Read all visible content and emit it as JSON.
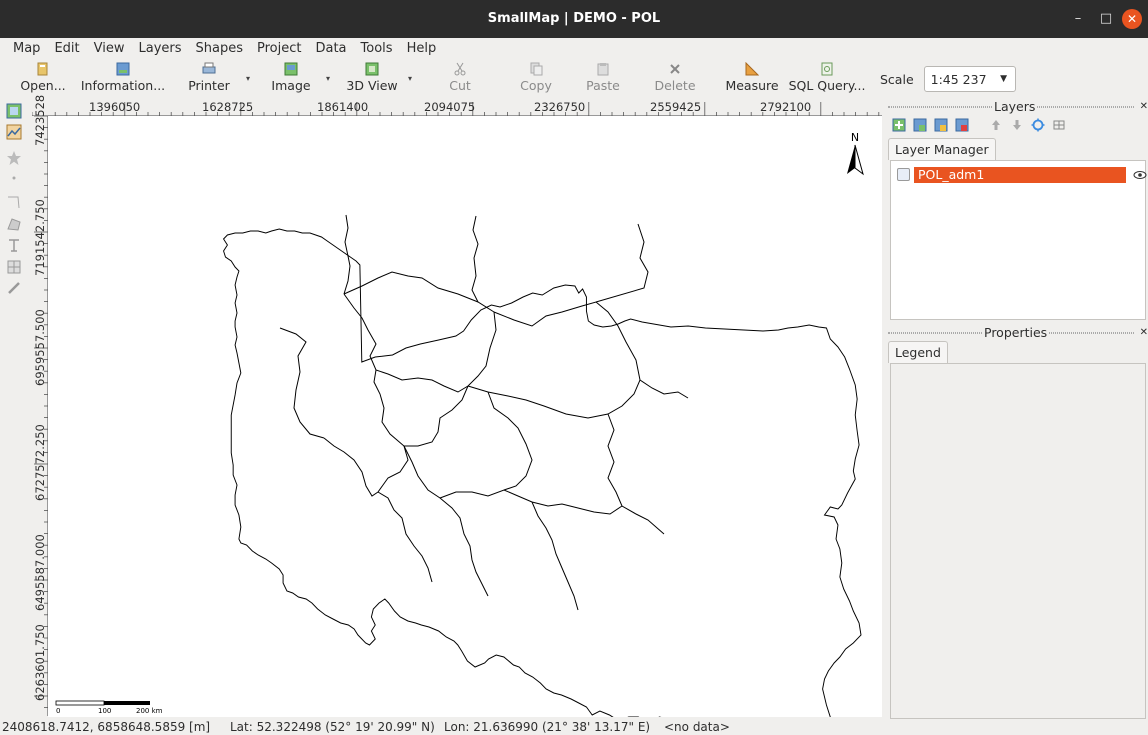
{
  "window": {
    "title": "SmallMap | DEMO - POL",
    "min_glyph": "–",
    "max_glyph": "□",
    "close_glyph": "✕"
  },
  "menu": [
    "Map",
    "Edit",
    "View",
    "Layers",
    "Shapes",
    "Project",
    "Data",
    "Tools",
    "Help"
  ],
  "toolbar": {
    "open": "Open...",
    "information": "Information...",
    "printer": "Printer",
    "image": "Image",
    "view3d": "3D View",
    "cut": "Cut",
    "copy": "Copy",
    "paste": "Paste",
    "delete": "Delete",
    "measure": "Measure",
    "sql": "SQL Query...",
    "scale_label": "Scale",
    "scale_value": "1:45 237",
    "dropdown_glyph": "▾",
    "scale_dropdown_glyph": "▼"
  },
  "ruler": {
    "x_labels": [
      "1396050",
      "1628725",
      "1861400",
      "2094075",
      "2326750",
      "2559425",
      "2792100"
    ],
    "y_labels": [
      "7423528",
      "7191542.750",
      "6959557.500",
      "6727572.250",
      "6495587.000",
      "6263601.750"
    ]
  },
  "map": {
    "north_label": "N",
    "scale_bar": {
      "labels": [
        "0",
        "100",
        "200 km"
      ]
    },
    "border_color": "#000000"
  },
  "layers_panel": {
    "title": "Layers",
    "tab": "Layer Manager",
    "layers": [
      {
        "name": "POL_adm1",
        "visible": true,
        "checked": false
      }
    ],
    "close_glyph": "✕"
  },
  "properties_panel": {
    "title": "Properties",
    "tab": "Legend",
    "close_glyph": "✕"
  },
  "status": {
    "coords": "2408618.7412,  6858648.5859 [m]",
    "lat": "Lat: 52.322498 (52° 19' 20.99\" N)",
    "lon": "Lon: 21.636990 (21° 38' 13.17\" E)",
    "value": "<no data>"
  },
  "colors": {
    "accent": "#e95420",
    "titlebar": "#2c2c2c",
    "canvas": "#ffffff"
  }
}
